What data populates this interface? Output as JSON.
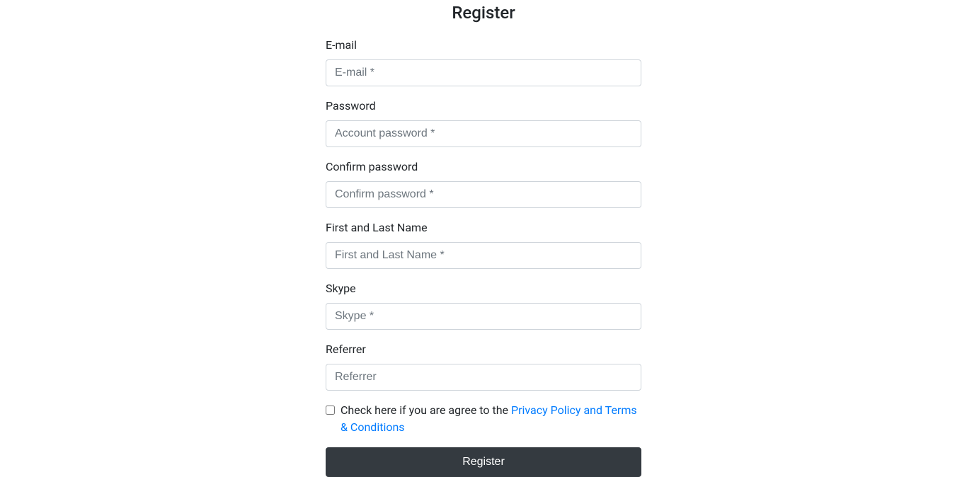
{
  "title": "Register",
  "fields": {
    "email": {
      "label": "E-mail",
      "placeholder": "E-mail *"
    },
    "password": {
      "label": "Password",
      "placeholder": "Account password *"
    },
    "confirm": {
      "label": "Confirm password",
      "placeholder": "Confirm password *"
    },
    "name": {
      "label": "First and Last Name",
      "placeholder": "First and Last Name *"
    },
    "skype": {
      "label": "Skype",
      "placeholder": "Skype *"
    },
    "referrer": {
      "label": "Referrer",
      "placeholder": "Referrer"
    }
  },
  "agreement": {
    "prefix": "Check here if you are agree to the ",
    "link": "Privacy Policy and Terms & Conditions"
  },
  "submit": "Register"
}
